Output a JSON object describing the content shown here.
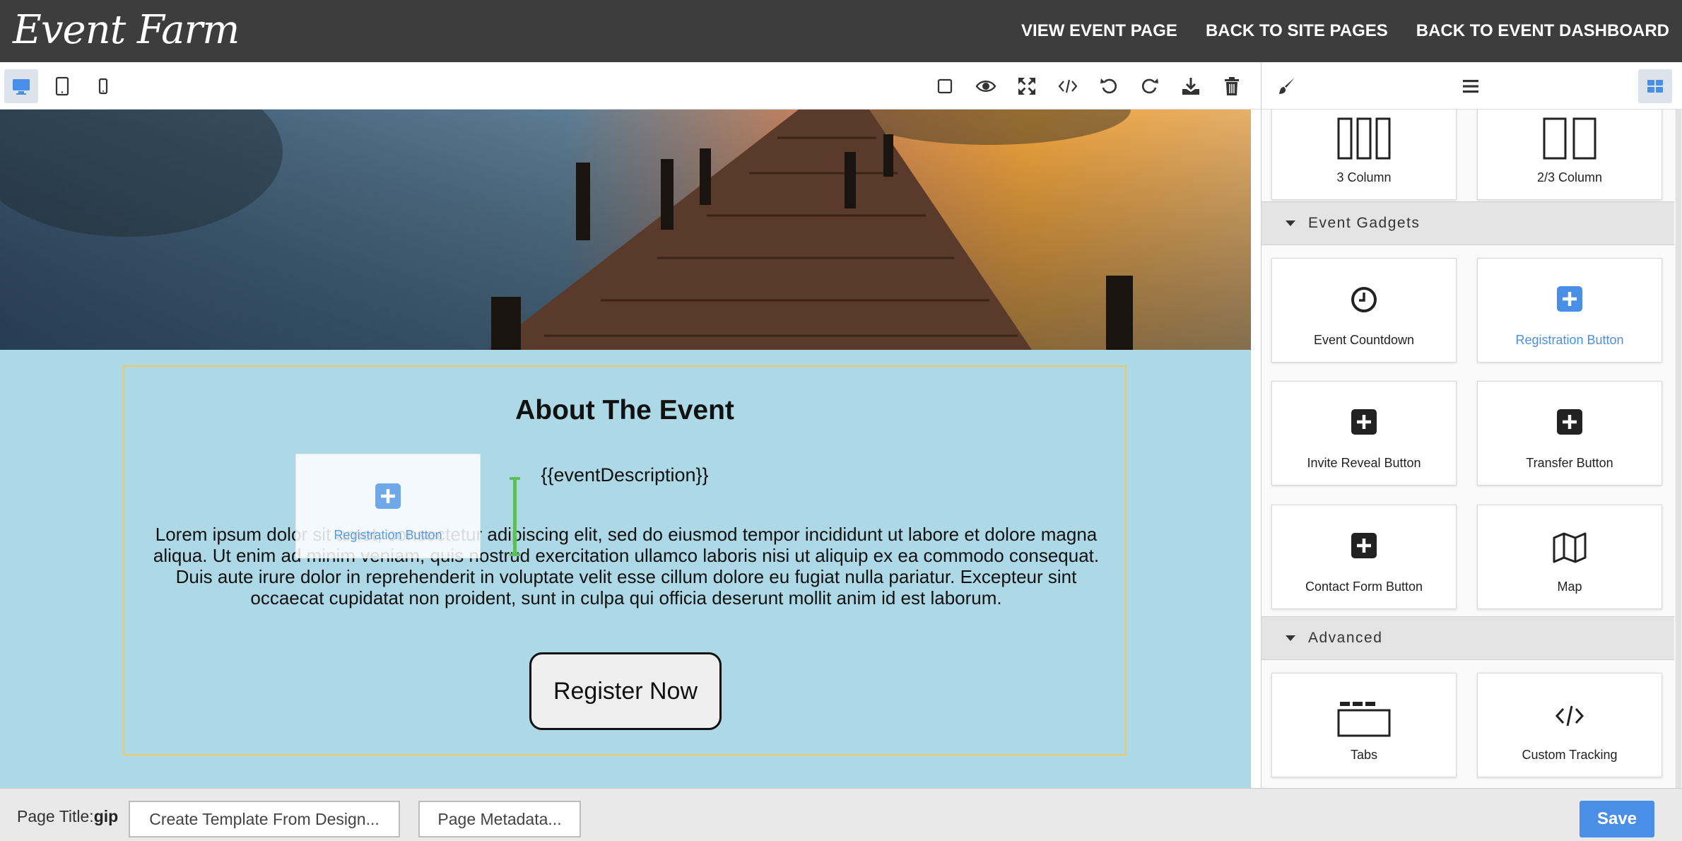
{
  "header": {
    "logo": "Event Farm",
    "nav": [
      "VIEW EVENT PAGE",
      "BACK TO SITE PAGES",
      "BACK TO EVENT DASHBOARD"
    ]
  },
  "toolbar": {
    "devices": [
      "desktop-icon",
      "tablet-icon",
      "mobile-icon"
    ],
    "active_device": "desktop",
    "tools": [
      "outline-square-icon",
      "eye-icon",
      "fullscreen-icon",
      "code-icon",
      "undo-icon",
      "redo-icon",
      "download-icon",
      "trash-icon"
    ],
    "panel_tools": [
      "paint-brush-icon",
      "layers-icon",
      "blocks-grid-icon"
    ]
  },
  "canvas": {
    "title": "About The Event",
    "description_placeholder": "{{eventDescription}}",
    "lorem": "Lorem ipsum dolor sit amet, consectetur adipiscing elit, sed do eiusmod tempor incididunt ut labore et dolore magna aliqua. Ut enim ad minim veniam, quis nostrud exercitation ullamco laboris nisi ut aliquip ex ea commodo consequat. Duis aute irure dolor in reprehenderit in voluptate velit esse cillum dolore eu fugiat nulla pariatur. Excepteur sint occaecat cupidatat non proident, sunt in culpa qui officia deserunt mollit anim id est laborum.",
    "register_button": "Register Now",
    "drag_ghost_label": "Registration Button"
  },
  "panel": {
    "layout_blocks": [
      {
        "label": "3 Column",
        "icon": "three-column-icon"
      },
      {
        "label": "2/3 Column",
        "icon": "two-column-icon"
      }
    ],
    "sections": [
      {
        "title": "Event Gadgets",
        "blocks": [
          {
            "label": "Event Countdown",
            "icon": "clock-icon"
          },
          {
            "label": "Registration Button",
            "icon": "plus-square-icon",
            "highlight": true
          },
          {
            "label": "Invite Reveal Button",
            "icon": "plus-square-icon"
          },
          {
            "label": "Transfer Button",
            "icon": "plus-square-icon"
          },
          {
            "label": "Contact Form Button",
            "icon": "plus-square-icon"
          },
          {
            "label": "Map",
            "icon": "map-icon"
          }
        ]
      },
      {
        "title": "Advanced",
        "blocks": [
          {
            "label": "Tabs",
            "icon": "tabs-icon"
          },
          {
            "label": "Custom Tracking",
            "icon": "code-icon"
          }
        ]
      }
    ]
  },
  "footer": {
    "page_title_label": "Page Title:",
    "page_title_value": "gip",
    "create_template": "Create Template From Design...",
    "page_metadata": "Page Metadata...",
    "save": "Save"
  },
  "colors": {
    "topbar": "#3d3d3d",
    "canvas_bg": "#add8e6",
    "accent": "#4a8fe7",
    "highlight_text": "#4a90e2",
    "insert_marker": "#5cbf5c",
    "content_border": "#f0c860"
  }
}
